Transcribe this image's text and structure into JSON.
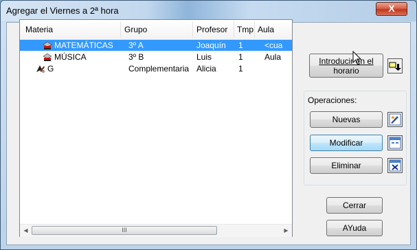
{
  "window": {
    "title": "Agregar el Viernes a 2ª hora",
    "close_glyph": "X"
  },
  "list": {
    "columns": [
      "Materia",
      "Grupo",
      "Profesor",
      "Tmp",
      "Aula"
    ],
    "rows": [
      {
        "materia": "MATEMÁTICAS",
        "grupo": "3º A",
        "profesor": "Joaquín",
        "tmp": "1",
        "aula": "<cua",
        "icon": "subject-icon",
        "selected": true
      },
      {
        "materia": "MÚSICA",
        "grupo": "3º B",
        "profesor": "Luis",
        "tmp": "1",
        "aula": "Aula",
        "icon": "subject-icon",
        "selected": false
      },
      {
        "materia": "G",
        "grupo": "Complementaria",
        "profesor": "Alicia",
        "tmp": "1",
        "aula": "",
        "icon": "complementary-icon",
        "selected": false
      }
    ],
    "scroll_grip": "III"
  },
  "buttons": {
    "introducir_line1": "Introducir en el",
    "introducir_line2": "horario",
    "operaciones_label": "Operaciones:",
    "nuevas": "Nuevas",
    "modificar": "Modificar",
    "eliminar": "Eliminar",
    "cerrar": "Cerrar",
    "ayuda": "AYuda"
  },
  "colors": {
    "selection": "#3399ff",
    "title_bar": "#c2d8ee",
    "close_button": "#c0351c"
  }
}
